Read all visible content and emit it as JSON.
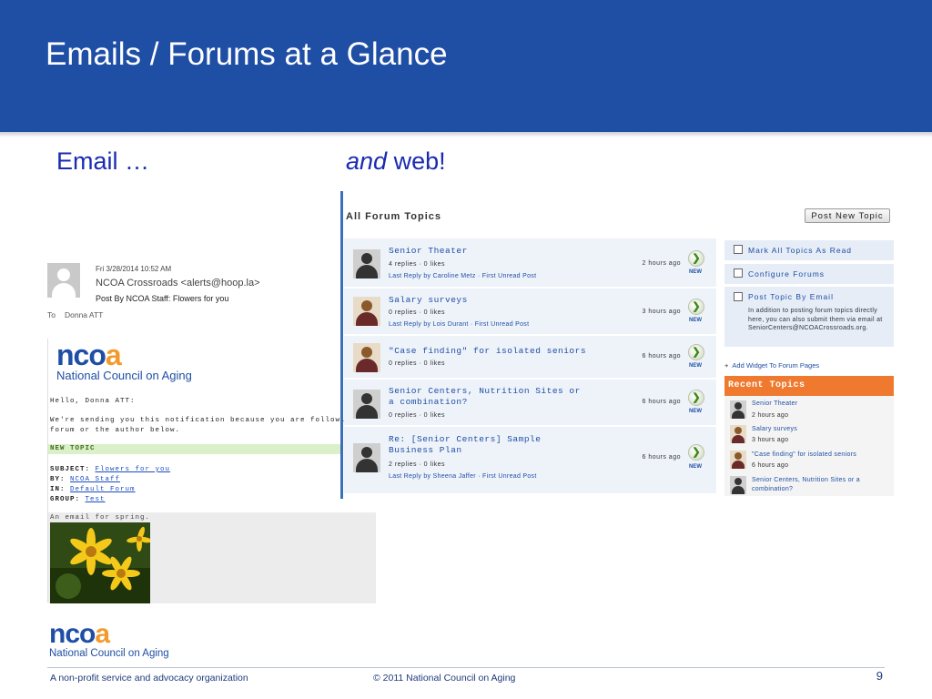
{
  "slide": {
    "title": "Emails / Forums at a Glance",
    "email_heading": "Email …",
    "web_heading_italic": "and",
    "web_heading_rest": " web!",
    "page_number": "9"
  },
  "email": {
    "date": "Fri 3/28/2014 10:52 AM",
    "from": "NCOA Crossroads <alerts@hoop.la>",
    "subject_line": "Post By NCOA Staff: Flowers for you",
    "to_label": "To",
    "to_name": "Donna ATT",
    "logo_text_1": "nco",
    "logo_text_2": "a",
    "logo_tagline": "National Council on Aging",
    "greeting": "Hello, Donna ATT:",
    "notice_line1": "We're sending you this notification because you are following eithe",
    "notice_line2": "forum or the author below.",
    "new_topic_label": "NEW TOPIC",
    "subject_label": "SUBJECT:",
    "subject_value": "Flowers for you",
    "by_label": "BY:",
    "by_value": "NCOA Staff",
    "in_label": "IN:",
    "in_value": "Default Forum",
    "group_label": "GROUP:",
    "group_value": "Test",
    "body_text": "An email for spring."
  },
  "forum": {
    "heading": "All Forum Topics",
    "post_button": "Post New Topic",
    "topics": [
      {
        "title": "Senior Theater",
        "stats": "4 replies · 0 likes",
        "last_reply": "Last Reply by Caroline Metz · First Unread Post",
        "time": "2 hours ago",
        "new": "NEW"
      },
      {
        "title": "Salary surveys",
        "stats": "0 replies · 0 likes",
        "last_reply": "Last Reply by Lois Durant · First Unread Post",
        "time": "3 hours ago",
        "new": "NEW"
      },
      {
        "title": "\"Case finding\" for isolated seniors",
        "stats": "0 replies · 0 likes",
        "last_reply": "",
        "time": "6 hours ago",
        "new": "NEW"
      },
      {
        "title": "Senior Centers, Nutrition Sites or a combination?",
        "stats": "0 replies · 0 likes",
        "last_reply": "",
        "time": "6 hours ago",
        "new": "NEW"
      },
      {
        "title": "Re: [Senior Centers] Sample Business Plan",
        "stats": "2 replies · 0 likes",
        "last_reply": "Last Reply by Sheena Jaffer · First Unread Post",
        "time": "6 hours ago",
        "new": "NEW"
      }
    ],
    "go_arrow": "❯"
  },
  "sidebar": {
    "mark_all": "Mark All Topics As Read",
    "configure": "Configure Forums",
    "post_by_email": "Post Topic By Email",
    "post_by_email_desc": "In addition to posting forum topics directly here, you can also submit them via email at SeniorCenters@NCOACrossroads.org.",
    "add_widget_plus": "+",
    "add_widget": "Add Widget To Forum Pages",
    "recent_heading": "Recent Topics",
    "recent": [
      {
        "title": "Senior Theater",
        "time": "2 hours ago"
      },
      {
        "title": "Salary surveys",
        "time": "3 hours ago"
      },
      {
        "title": "\"Case finding\" for isolated seniors",
        "time": "6 hours ago"
      },
      {
        "title": "Senior Centers, Nutrition Sites or a combination?",
        "time": ""
      }
    ]
  },
  "footer": {
    "left": "A non-profit service and advocacy organization",
    "center": "© 2011 National Council on Aging"
  },
  "colors": {
    "banner": "#1f4ea5",
    "heading_blue": "#1a2bb0",
    "ncoa_orange": "#f39a2c",
    "recent_orange": "#ef7a2f"
  }
}
